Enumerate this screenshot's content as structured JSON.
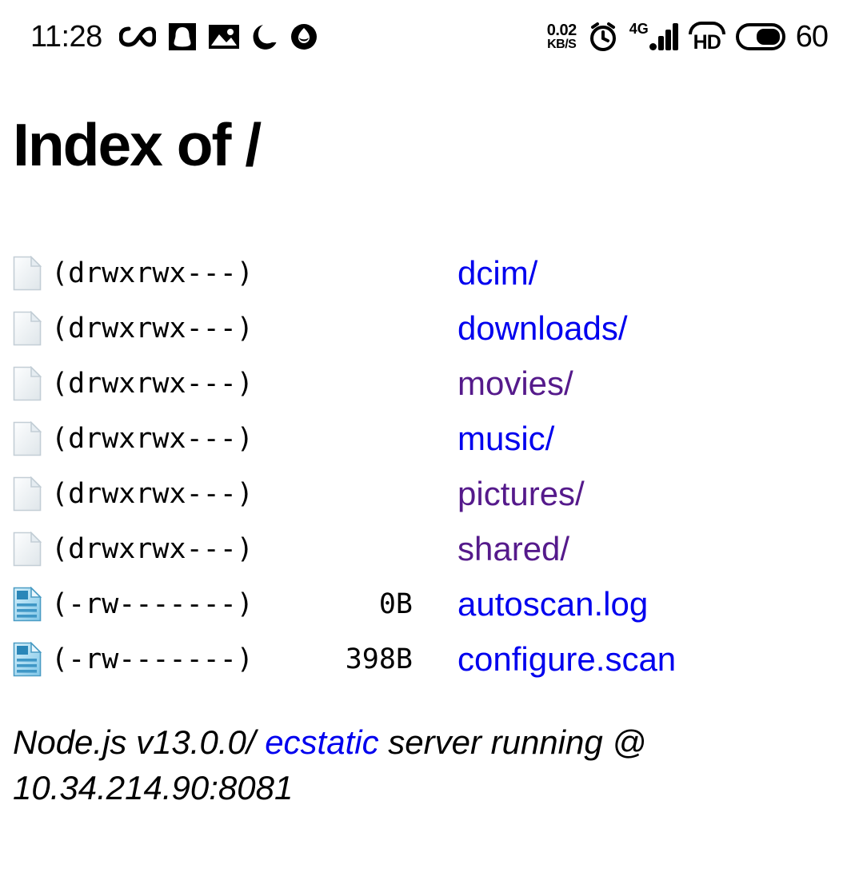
{
  "status_bar": {
    "clock": "11:28",
    "left_icons": [
      {
        "name": "infinity-icon",
        "glyph": "∞"
      },
      {
        "name": "qq-messenger-icon",
        "glyph": "QQ"
      },
      {
        "name": "screenshot-image-icon",
        "glyph": "IMG"
      },
      {
        "name": "do-not-disturb-moon-icon",
        "glyph": "☽"
      },
      {
        "name": "face-app-icon",
        "glyph": "●"
      }
    ],
    "net_speed_value": "0.02",
    "net_speed_unit": "KB/S",
    "alarm_icon": "alarm-clock-icon",
    "network_type": "4G",
    "signal_icon": "signal-bars-icon",
    "hd_label": "HD",
    "battery_percent": "60",
    "battery_fill_ratio": 0.6
  },
  "page": {
    "title": "Index of /"
  },
  "file_list": {
    "rows": [
      {
        "icon": "blank-page-icon",
        "permissions": "(drwxrwx---)",
        "size": "",
        "name": "dcim/",
        "link_state": "new"
      },
      {
        "icon": "blank-page-icon",
        "permissions": "(drwxrwx---)",
        "size": "",
        "name": "downloads/",
        "link_state": "new"
      },
      {
        "icon": "blank-page-icon",
        "permissions": "(drwxrwx---)",
        "size": "",
        "name": "movies/",
        "link_state": "visited"
      },
      {
        "icon": "blank-page-icon",
        "permissions": "(drwxrwx---)",
        "size": "",
        "name": "music/",
        "link_state": "new"
      },
      {
        "icon": "blank-page-icon",
        "permissions": "(drwxrwx---)",
        "size": "",
        "name": "pictures/",
        "link_state": "visited"
      },
      {
        "icon": "blank-page-icon",
        "permissions": "(drwxrwx---)",
        "size": "",
        "name": "shared/",
        "link_state": "visited"
      },
      {
        "icon": "text-document-icon",
        "permissions": "(-rw-------)",
        "size": "0B",
        "name": "autoscan.log",
        "link_state": "new"
      },
      {
        "icon": "text-document-icon",
        "permissions": "(-rw-------)",
        "size": "398B",
        "name": "configure.scan",
        "link_state": "new"
      }
    ]
  },
  "footer": {
    "prefix": "Node.js v13.0.0/ ",
    "link_label": "ecstatic",
    "suffix": " server running @ 10.34.214.90:8081"
  },
  "colors": {
    "link_new": "#0000ee",
    "link_visited": "#551a8b",
    "text": "#000000",
    "background": "#ffffff"
  }
}
